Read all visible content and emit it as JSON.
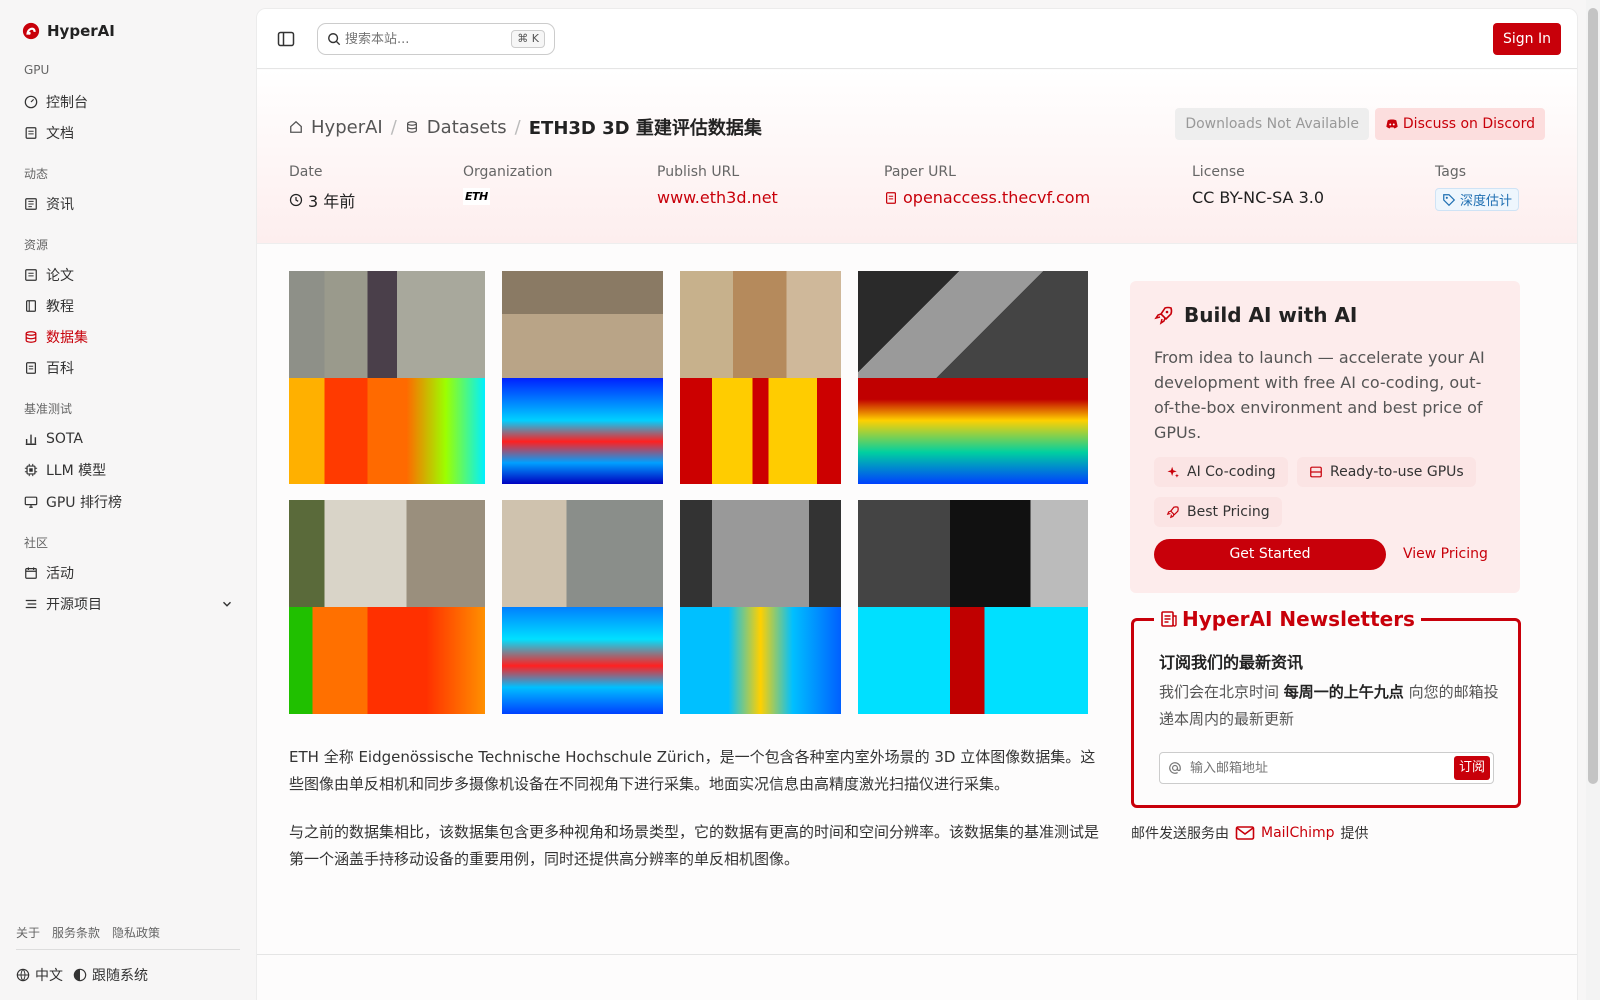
{
  "brand": {
    "name": "HyperAI"
  },
  "sidebar": {
    "sections": [
      {
        "title": "GPU",
        "items": [
          {
            "label": "控制台",
            "icon": "dashboard-icon"
          },
          {
            "label": "文档",
            "icon": "doc-icon"
          }
        ]
      },
      {
        "title": "动态",
        "items": [
          {
            "label": "资讯",
            "icon": "news-icon"
          }
        ]
      },
      {
        "title": "资源",
        "items": [
          {
            "label": "论文",
            "icon": "paper-icon"
          },
          {
            "label": "教程",
            "icon": "book-icon"
          },
          {
            "label": "数据集",
            "icon": "database-icon"
          },
          {
            "label": "百科",
            "icon": "wiki-icon"
          }
        ]
      },
      {
        "title": "基准测试",
        "items": [
          {
            "label": "SOTA",
            "icon": "chart-icon"
          },
          {
            "label": "LLM 模型",
            "icon": "chip-icon"
          },
          {
            "label": "GPU 排行榜",
            "icon": "monitor-icon"
          }
        ]
      },
      {
        "title": "社区",
        "items": [
          {
            "label": "活动",
            "icon": "event-icon"
          },
          {
            "label": "开源项目",
            "icon": "list-icon"
          }
        ]
      }
    ],
    "active_item": "数据集",
    "footer_links": [
      "关于",
      "服务条款",
      "隐私政策"
    ],
    "language": "中文",
    "theme": "跟随系统"
  },
  "topbar": {
    "search_placeholder": "搜索本站...",
    "shortcut": "⌘ K",
    "signin": "Sign In"
  },
  "breadcrumb": {
    "home": "HyperAI",
    "datasets": "Datasets",
    "current": "ETH3D 3D 重建评估数据集"
  },
  "actions": {
    "downloads": "Downloads Not Available",
    "discord": "Discuss on Discord"
  },
  "meta": {
    "date_label": "Date",
    "date_value": "3 年前",
    "org_label": "Organization",
    "org_logo_text": "ETH",
    "publish_label": "Publish URL",
    "publish_value": "www.eth3d.net",
    "paper_label": "Paper URL",
    "paper_value": "openaccess.thecvf.com",
    "license_label": "License",
    "license_value": "CC BY-NC-SA 3.0",
    "tags_label": "Tags",
    "tag_value": "深度估计"
  },
  "description": {
    "p1": "ETH 全称 Eidgenössische Technische Hochschule Zürich，是一个包含各种室内室外场景的 3D 立体图像数据集。这些图像由单反相机和同步多摄像机设备在不同视角下进行采集。地面实况信息由高精度激光扫描仪进行采集。",
    "p2": "与之前的数据集相比，该数据集包含更多种视角和场景类型，它的数据有更高的时间和空间分辨率。该数据集的基准测试是第一个涵盖手持移动设备的重要用例，同时还提供高分辨率的单反相机图像。"
  },
  "promo": {
    "title": "Build AI with AI",
    "body": "From idea to launch — accelerate your AI development with free AI co-coding, out-of-the-box environment and best price of GPUs.",
    "chips": [
      "AI Co-coding",
      "Ready-to-use GPUs",
      "Best Pricing"
    ],
    "cta": "Get Started",
    "pricing": "View Pricing"
  },
  "newsletter": {
    "title": "HyperAI Newsletters",
    "subtitle": "订阅我们的最新资讯",
    "text_pre": "我们会在北京时间",
    "text_bold": "每周一的上午九点",
    "text_post": "向您的邮箱投递本周内的最新更新",
    "placeholder": "输入邮箱地址",
    "button": "订阅",
    "mail_pre": "邮件发送服务由",
    "mail_brand": "MailChimp",
    "mail_post": "提供"
  },
  "colors": {
    "accent": "#c8000a"
  }
}
